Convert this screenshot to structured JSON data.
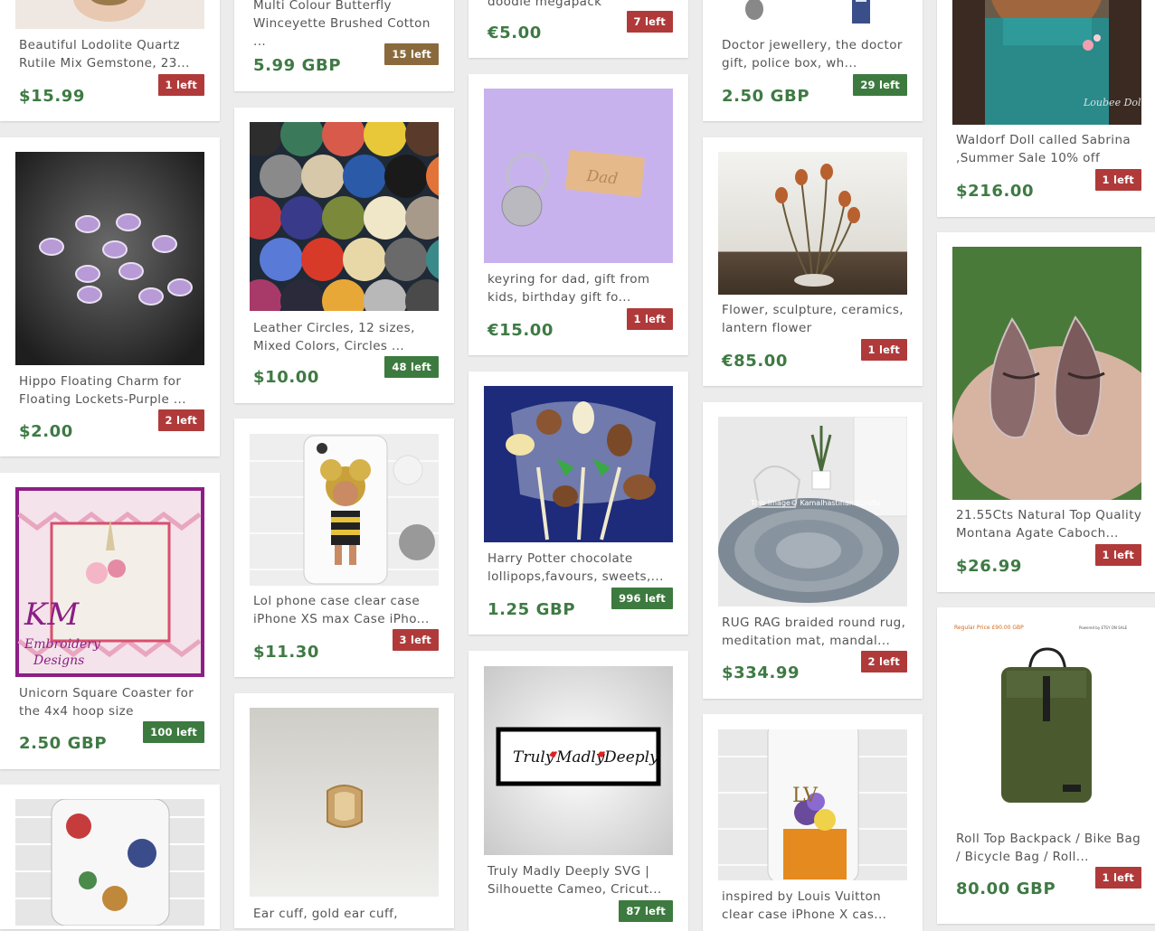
{
  "colors": {
    "page_background": "#ececec",
    "price_green": "#3f7a44",
    "badge_red": "#b03a3a",
    "badge_green": "#3d7a3f",
    "badge_olive": "#8a6a3c"
  },
  "products": [
    {
      "title": "Beautiful Lodolite Quartz Rutile Mix Gemstone, 23...",
      "price": "$15.99",
      "stock": "1 left",
      "badge_color": "red"
    },
    {
      "title": "Hippo Floating Charm for Floating Lockets-Purple ...",
      "price": "$2.00",
      "stock": "2 left",
      "badge_color": "red"
    },
    {
      "title": "Unicorn Square Coaster for the 4x4 hoop size",
      "price": "2.50 GBP",
      "stock": "100 left",
      "badge_color": "green",
      "image_text": [
        "KM",
        "Embroidery",
        "Designs"
      ]
    },
    {
      "title": "Multi Colour Butterfly Winceyette Brushed Cotton ...",
      "price": "5.99 GBP",
      "stock": "15 left",
      "badge_color": "olive"
    },
    {
      "title": "Leather Circles, 12 sizes, Mixed Colors, Circles ...",
      "price": "$10.00",
      "stock": "48 left",
      "badge_color": "green"
    },
    {
      "title": "Lol phone case clear case iPhone XS max Case iPho...",
      "price": "$11.30",
      "stock": "3 left",
      "badge_color": "red"
    },
    {
      "title": "Ear cuff, gold ear cuff,",
      "price": "",
      "stock": "",
      "badge_color": ""
    },
    {
      "title": "doodle megapack",
      "price": "€5.00",
      "stock": "7 left",
      "badge_color": "red"
    },
    {
      "title": "keyring for dad, gift from kids, birthday gift fo...",
      "price": "€15.00",
      "stock": "1 left",
      "badge_color": "red",
      "image_text": "Dad"
    },
    {
      "title": "Harry Potter chocolate lollipops,favours, sweets,...",
      "price": "1.25 GBP",
      "stock": "996 left",
      "badge_color": "green"
    },
    {
      "title": "Truly Madly Deeply SVG | Silhouette Cameo, Cricut...",
      "price": "",
      "stock": "87 left",
      "badge_color": "green",
      "image_text": [
        "Truly",
        "Madly",
        "Deeply"
      ]
    },
    {
      "title": "Doctor jewellery, the doctor gift, police box, wh...",
      "price": "2.50 GBP",
      "stock": "29 left",
      "badge_color": "green"
    },
    {
      "title": "Flower, sculpture, ceramics, lantern flower",
      "price": "€85.00",
      "stock": "1 left",
      "badge_color": "red"
    },
    {
      "title": "RUG RAG braided round rug, meditation mat, mandal...",
      "price": "$334.99",
      "stock": "2 left",
      "badge_color": "red",
      "image_text": "This Image© Kamalhastihandicrafts"
    },
    {
      "title": "inspired by Louis Vuitton clear case iPhone X cas...",
      "price": "",
      "stock": "",
      "badge_color": "",
      "image_text": "LV"
    },
    {
      "title": "Waldorf Doll called Sabrina ,Summer Sale 10% off",
      "price": "$216.00",
      "stock": "1 left",
      "badge_color": "red",
      "image_text": "Loubee Doll"
    },
    {
      "title": "21.55Cts Natural Top Quality Montana Agate Caboch...",
      "price": "$26.99",
      "stock": "1 left",
      "badge_color": "red"
    },
    {
      "title": "Roll Top Backpack / Bike Bag / Bicycle Bag / Roll...",
      "price": "80.00 GBP",
      "stock": "1 left",
      "badge_color": "red",
      "image_text": [
        "Regular Price £90.00 GBP",
        "Powered by ETSY ON SALE"
      ]
    }
  ]
}
